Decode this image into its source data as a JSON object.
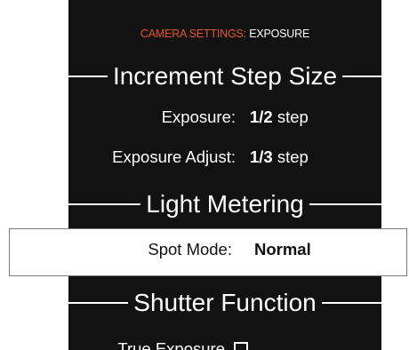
{
  "header": {
    "breadcrumb_section": "CAMERA SETTINGS:",
    "breadcrumb_page": "EXPOSURE"
  },
  "sections": {
    "increment": {
      "title": "Increment Step Size",
      "exposure": {
        "label": "Exposure:",
        "value_bold": "1/2",
        "value_unit": "step"
      },
      "exposure_adjust": {
        "label": "Exposure Adjust:",
        "value_bold": "1/3",
        "value_unit": "step"
      }
    },
    "metering": {
      "title": "Light Metering",
      "spot_mode": {
        "label": "Spot Mode:",
        "value": "Normal"
      }
    },
    "shutter": {
      "title": "Shutter Function",
      "true_exposure": {
        "label": "True Exposure",
        "checked": false
      }
    }
  },
  "colors": {
    "background": "#121212",
    "accent": "#e2572b",
    "text": "#ffffff",
    "selected_background": "#ffffff"
  }
}
